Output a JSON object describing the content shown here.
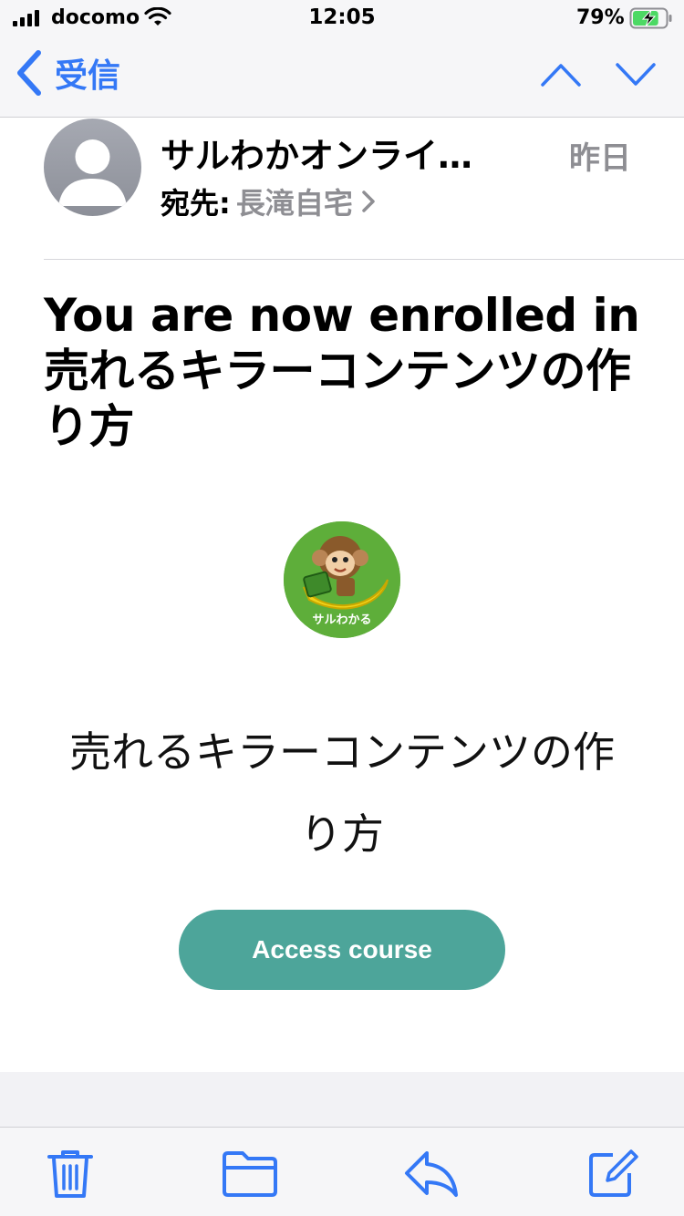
{
  "status": {
    "carrier": "docomo",
    "time": "12:05",
    "battery": "79%",
    "battery_level": 0.79
  },
  "nav": {
    "back_label": "受信"
  },
  "header": {
    "sender": "サルわかオンライ…",
    "date": "昨日",
    "to_label": "宛先:",
    "to_name": "長滝自宅"
  },
  "subject": "You are now enrolled in 売れるキラーコンテンツの作り方",
  "course": {
    "logo_text": "サルわかる",
    "title": "売れるキラーコンテンツの作り方",
    "button_label": "Access course",
    "button_color": "#4da59a"
  },
  "colors": {
    "accent": "#3478f6",
    "logo_bg": "#5eae3a"
  },
  "toolbar": {
    "icons": [
      "trash-icon",
      "folder-icon",
      "reply-icon",
      "compose-icon"
    ]
  }
}
